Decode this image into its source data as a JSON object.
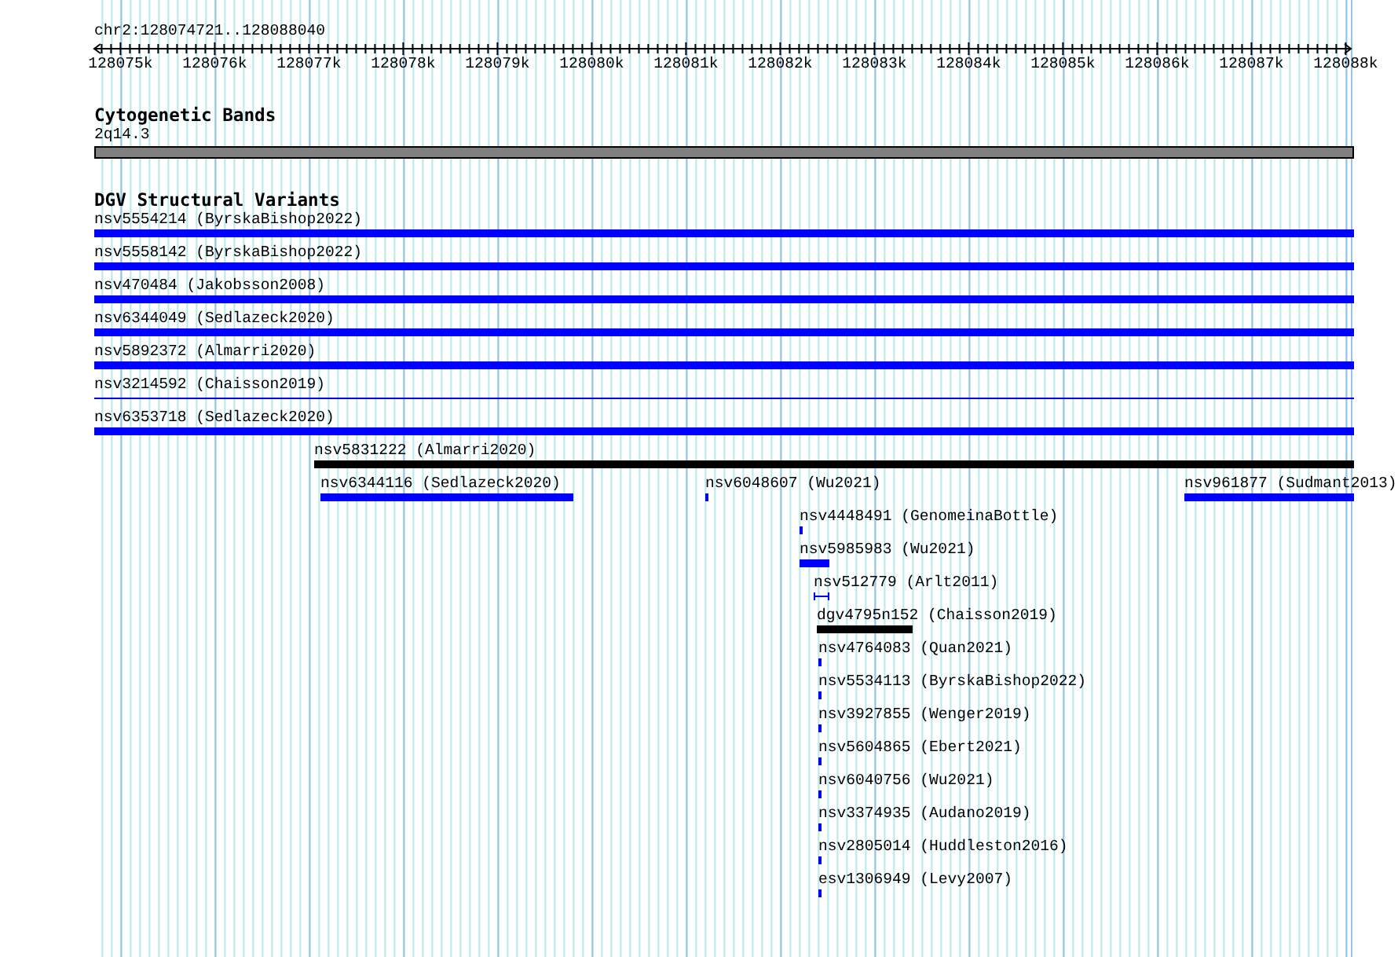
{
  "location": "chr2:128074721..128088040",
  "ruler": {
    "labels": [
      "128075k",
      "128076k",
      "128077k",
      "128078k",
      "128079k",
      "128080k",
      "128081k",
      "128082k",
      "128083k",
      "128084k",
      "128085k",
      "128086k",
      "128087k",
      "128088k"
    ]
  },
  "cytogenetic_track": {
    "title": "Cytogenetic Bands",
    "band": {
      "label": "2q14.3"
    }
  },
  "variant_track": {
    "title": "DGV Structural Variants",
    "features": [
      {
        "label": "nsv5554214 (ByrskaBishop2022)",
        "kind": "bar",
        "color": "#0000ff"
      },
      {
        "label": "nsv5558142 (ByrskaBishop2022)",
        "kind": "bar",
        "color": "#0000ff"
      },
      {
        "label": "nsv470484 (Jakobsson2008)",
        "kind": "bar",
        "color": "#0000ff"
      },
      {
        "label": "nsv6344049 (Sedlazeck2020)",
        "kind": "bar",
        "color": "#0000ff"
      },
      {
        "label": "nsv5892372 (Almarri2020)",
        "kind": "bar",
        "color": "#0000ff"
      },
      {
        "label": "nsv3214592 (Chaisson2019)",
        "kind": "line",
        "color": "#0000ff"
      },
      {
        "label": "nsv6353718 (Sedlazeck2020)",
        "kind": "bar",
        "color": "#0000ff"
      },
      {
        "label": "nsv5831222 (Almarri2020)",
        "kind": "bar",
        "color": "#000000"
      },
      {
        "label": "nsv6344116 (Sedlazeck2020)",
        "kind": "bar",
        "color": "#0000ff"
      },
      {
        "label": "nsv6048607 (Wu2021)",
        "kind": "bar",
        "color": "#0000ff"
      },
      {
        "label": "nsv961877 (Sudmant2013)",
        "kind": "bar",
        "color": "#0000ff"
      },
      {
        "label": "nsv4448491 (GenomeinaBottle)",
        "kind": "bar",
        "color": "#0000ff"
      },
      {
        "label": "nsv5985983 (Wu2021)",
        "kind": "bar",
        "color": "#0000ff"
      },
      {
        "label": "nsv512779 (Arlt2011)",
        "kind": "capped",
        "color": "#0000ff"
      },
      {
        "label": "dgv4795n152 (Chaisson2019)",
        "kind": "bar",
        "color": "#000000"
      },
      {
        "label": "nsv4764083 (Quan2021)",
        "kind": "bar",
        "color": "#0000ff"
      },
      {
        "label": "nsv5534113 (ByrskaBishop2022)",
        "kind": "bar",
        "color": "#0000ff"
      },
      {
        "label": "nsv3927855 (Wenger2019)",
        "kind": "bar",
        "color": "#0000ff"
      },
      {
        "label": "nsv5604865 (Ebert2021)",
        "kind": "bar",
        "color": "#0000ff"
      },
      {
        "label": "nsv6040756 (Wu2021)",
        "kind": "bar",
        "color": "#0000ff"
      },
      {
        "label": "nsv3374935 (Audano2019)",
        "kind": "bar",
        "color": "#0000ff"
      },
      {
        "label": "nsv2805014 (Huddleston2016)",
        "kind": "bar",
        "color": "#0000ff"
      },
      {
        "label": "esv1306949 (Levy2007)",
        "kind": "bar",
        "color": "#0000ff"
      }
    ]
  }
}
